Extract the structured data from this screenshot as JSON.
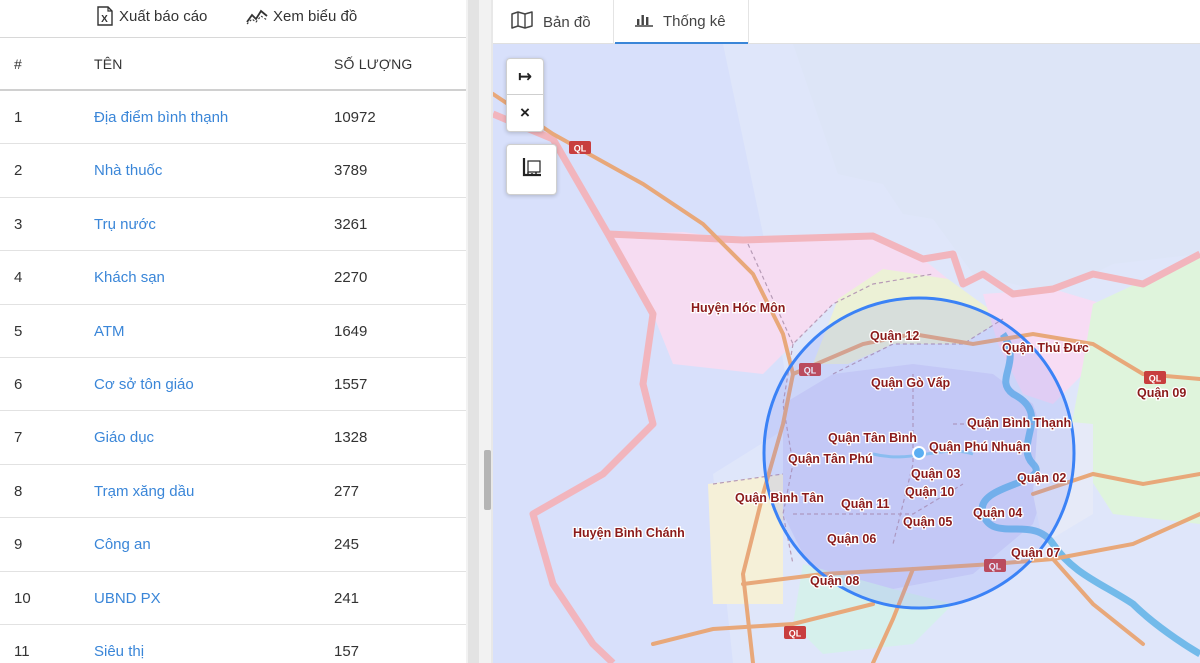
{
  "toolbar": {
    "export_label": "Xuất báo cáo",
    "chart_label": "Xem biểu đồ"
  },
  "table": {
    "headers": {
      "index": "#",
      "name": "TÊN",
      "count": "SỐ LƯỢNG"
    },
    "rows": [
      {
        "index": "1",
        "name": "Địa điểm bình thạnh",
        "count": "10972"
      },
      {
        "index": "2",
        "name": "Nhà thuốc",
        "count": "3789"
      },
      {
        "index": "3",
        "name": "Trụ nước",
        "count": "3261"
      },
      {
        "index": "4",
        "name": "Khách sạn",
        "count": "2270"
      },
      {
        "index": "5",
        "name": "ATM",
        "count": "1649"
      },
      {
        "index": "6",
        "name": "Cơ sở tôn giáo",
        "count": "1557"
      },
      {
        "index": "7",
        "name": "Giáo dục",
        "count": "1328"
      },
      {
        "index": "8",
        "name": "Trạm xăng dầu",
        "count": "277"
      },
      {
        "index": "9",
        "name": "Công an",
        "count": "245"
      },
      {
        "index": "10",
        "name": "UBND PX",
        "count": "241"
      },
      {
        "index": "11",
        "name": "Siêu thị",
        "count": "157"
      }
    ]
  },
  "tabs": {
    "map_label": "Bản đồ",
    "stats_label": "Thống kê"
  },
  "map": {
    "controls": {
      "expand_symbol": "↦",
      "close_symbol": "×"
    },
    "road_label": "QL",
    "districts": {
      "hoc_mon": "Huyện Hóc Môn",
      "binh_chanh": "Huyện Bình Chánh",
      "q12": "Quận 12",
      "thu_duc": "Quận Thủ Đức",
      "q09": "Quận 09",
      "go_vap": "Quận Gò Vấp",
      "binh_thanh": "Quận Bình Thạnh",
      "tan_binh": "Quận Tân Bình",
      "phu_nhuan": "Quận Phú Nhuận",
      "tan_phu": "Quận Tân Phú",
      "q03": "Quận 03",
      "q10": "Quận 10",
      "q02": "Quận 02",
      "binh_tan": "Quận Bình Tân",
      "q11": "Quận 11",
      "q04": "Quận 04",
      "q05": "Quận 05",
      "q06": "Quận 06",
      "q07": "Quận 07",
      "q08": "Quận 08"
    }
  },
  "colors": {
    "link": "#3a86d8",
    "tab_active": "#3a86d8",
    "district_label": "#8b1a1a",
    "radius_circle": "#3b82f6",
    "road": "#e8a87a",
    "road_badge": "#c83e3e"
  }
}
